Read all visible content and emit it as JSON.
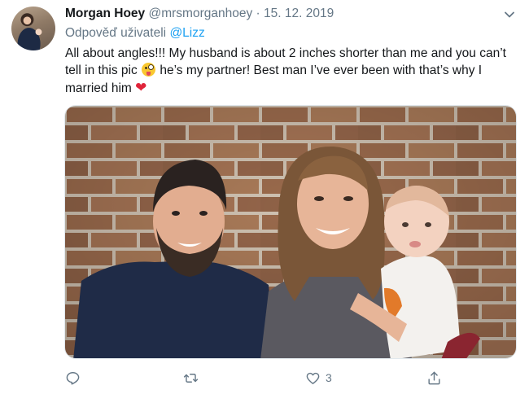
{
  "tweet": {
    "author": {
      "display_name": "Morgan Hoey",
      "handle": "@mrsmorganhoey",
      "separator": "·",
      "date": "15. 12. 2019"
    },
    "reply": {
      "prefix": "Odpověď uživateli",
      "mention": "@Lizz"
    },
    "text": {
      "part1": "All about angles!!! My husband is about 2 inches shorter than me and you can’t tell in this pic",
      "part2": "he’s my partner! Best man I’ve ever been with that’s why I married him"
    },
    "emojis": [
      "winking-tongue-face-emoji",
      "red-heart-emoji"
    ],
    "actions": {
      "like_count": "3"
    },
    "icons": [
      "chevron-down-icon",
      "reply-icon",
      "retweet-icon",
      "heart-icon",
      "share-icon"
    ]
  }
}
